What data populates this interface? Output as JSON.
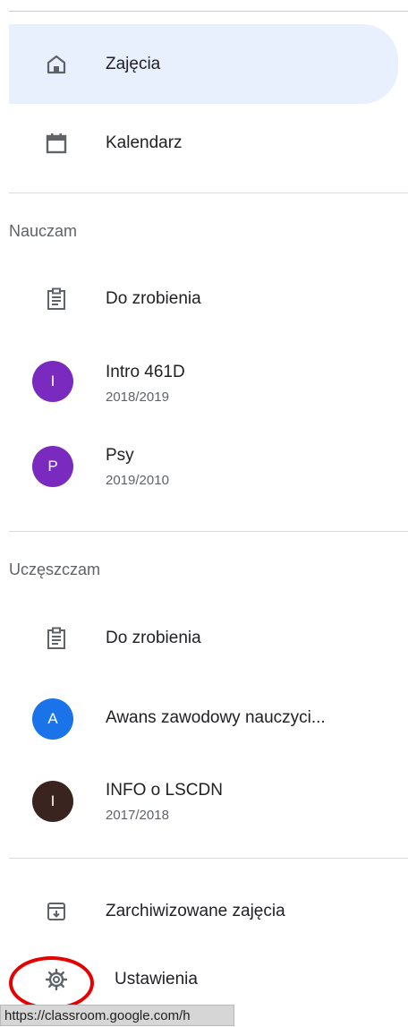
{
  "nav": {
    "classes_label": "Zajęcia",
    "calendar_label": "Kalendarz",
    "archived_label": "Zarchiwizowane zajęcia",
    "settings_label": "Ustawienia"
  },
  "teaching": {
    "title": "Nauczam",
    "todo_label": "Do zrobienia",
    "courses": [
      {
        "initial": "I",
        "name": "Intro 461D",
        "term": "2018/2019",
        "color": "#7b2abf"
      },
      {
        "initial": "P",
        "name": "Psy",
        "term": "2019/2010",
        "color": "#7b2abf"
      }
    ]
  },
  "enrolled": {
    "title": "Uczęszczam",
    "todo_label": "Do zrobienia",
    "courses": [
      {
        "initial": "A",
        "name": "Awans zawodowy nauczyci...",
        "color": "#1a73e8"
      },
      {
        "initial": "I",
        "name": "INFO o LSCDN",
        "term": "2017/2018",
        "color": "#3a2420"
      }
    ]
  },
  "status_bar": {
    "url": "https://classroom.google.com/h"
  },
  "colors": {
    "active_bg": "#e8f0fe",
    "highlight": "#e60000"
  }
}
